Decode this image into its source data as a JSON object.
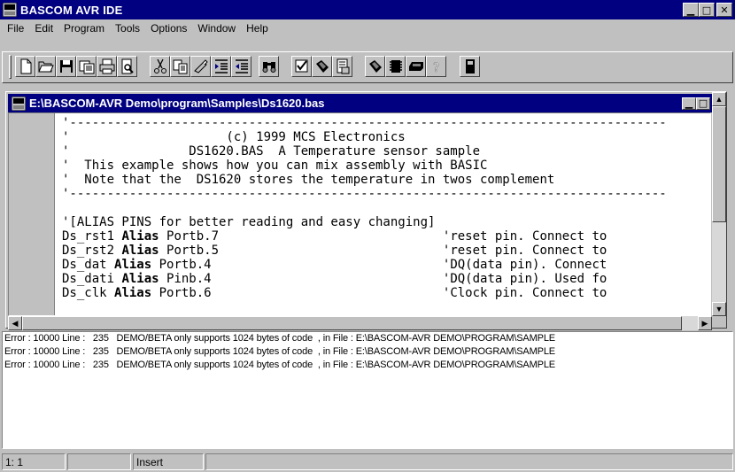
{
  "window": {
    "title": "BASCOM AVR IDE"
  },
  "menu": [
    "File",
    "Edit",
    "Program",
    "Tools",
    "Options",
    "Window",
    "Help"
  ],
  "toolbar": {
    "buttons": [
      "new-file-icon",
      "open-file-icon",
      "save-icon",
      "save-as-icon",
      "print-icon",
      "print-preview-icon",
      "cut-icon",
      "copy-icon",
      "paste-icon",
      "indent-icon",
      "unindent-icon",
      "find-icon",
      "syntax-check-icon",
      "compile-icon",
      "compile-result-icon",
      "program-chip-icon",
      "simulate-icon",
      "terminal-icon",
      "help-icon",
      "lcd-designer-icon"
    ]
  },
  "document": {
    "title": "E:\\BASCOM-AVR Demo\\program\\Samples\\Ds1620.bas",
    "lines": [
      [
        {
          "t": "'--------------------------------------------------------------------------------"
        }
      ],
      [
        {
          "t": "'                     (c) 1999 MCS Electronics"
        }
      ],
      [
        {
          "t": "'                DS1620.BAS  A Temperature sensor sample"
        }
      ],
      [
        {
          "t": "'  This example shows how you can mix assembly with BASIC"
        }
      ],
      [
        {
          "t": "'  Note that the  DS1620 stores the temperature in twos complement"
        }
      ],
      [
        {
          "t": "'--------------------------------------------------------------------------------"
        }
      ],
      [
        {
          "t": ""
        }
      ],
      [
        {
          "t": "'[ALIAS PINS for better reading and easy changing]"
        }
      ],
      [
        {
          "t": "Ds_rst1 "
        },
        {
          "t": "Alias",
          "b": true
        },
        {
          "t": " Portb.7                              'reset pin. Connect to"
        }
      ],
      [
        {
          "t": "Ds_rst2 "
        },
        {
          "t": "Alias",
          "b": true
        },
        {
          "t": " Portb.5                              'reset pin. Connect to"
        }
      ],
      [
        {
          "t": "Ds_dat "
        },
        {
          "t": "Alias",
          "b": true
        },
        {
          "t": " Portb.4                               'DQ(data pin). Connect"
        }
      ],
      [
        {
          "t": "Ds_dati "
        },
        {
          "t": "Alias",
          "b": true
        },
        {
          "t": " Pinb.4                               'DQ(data pin). Used fo"
        }
      ],
      [
        {
          "t": "Ds_clk "
        },
        {
          "t": "Alias",
          "b": true
        },
        {
          "t": " Portb.6                               'Clock pin. Connect to"
        }
      ]
    ]
  },
  "errors": [
    "Error : 10000 Line :   235   DEMO/BETA only supports 1024 bytes of code  , in File : E:\\BASCOM-AVR DEMO\\PROGRAM\\SAMPLE",
    "Error : 10000 Line :   235   DEMO/BETA only supports 1024 bytes of code  , in File : E:\\BASCOM-AVR DEMO\\PROGRAM\\SAMPLE",
    "Error : 10000 Line :   235   DEMO/BETA only supports 1024 bytes of code  , in File : E:\\BASCOM-AVR DEMO\\PROGRAM\\SAMPLE"
  ],
  "status": {
    "position": "1: 1",
    "mode": "Insert"
  },
  "colors": {
    "titlebar": "#000080",
    "face": "#c0c0c0"
  }
}
